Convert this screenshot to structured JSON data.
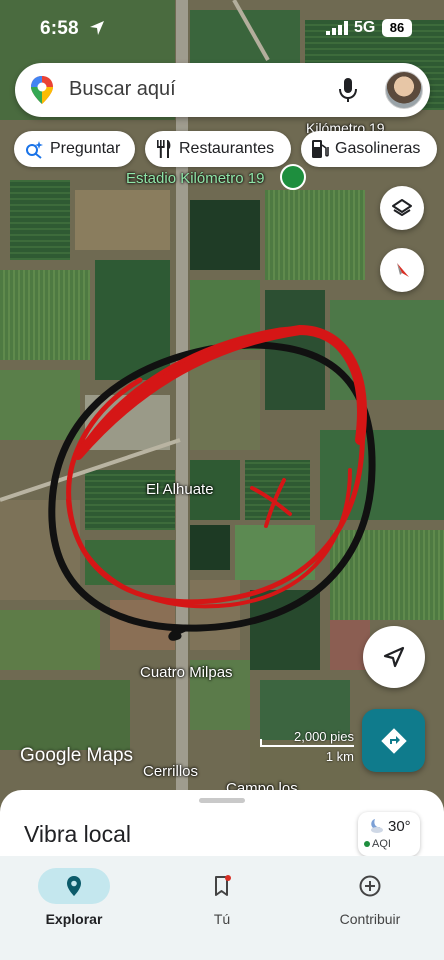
{
  "status_bar": {
    "time": "6:58",
    "network": "5G",
    "battery": "86"
  },
  "search": {
    "placeholder": "Buscar aquí"
  },
  "chips": [
    {
      "label": "Preguntar"
    },
    {
      "label": "Restaurantes"
    },
    {
      "label": "Gasolineras"
    }
  ],
  "map": {
    "labels": {
      "stadium": "Estadio Kilómetro 19",
      "km19": "Kilómetro 19",
      "alhuate": "El Alhuate",
      "cuatro_milpas": "Cuatro Milpas",
      "cerrillos": "Cerrillos",
      "campo": "Campo los"
    },
    "logo": "Google Maps",
    "scale": {
      "imperial": "2,000 pies",
      "metric": "1 km"
    },
    "annotation_color": "#e01b1b"
  },
  "sheet": {
    "title": "Vibra local"
  },
  "weather": {
    "temperature": "30°",
    "aqi_label": "AQI"
  },
  "nav": {
    "items": [
      {
        "label": "Explorar",
        "icon": "location-pin-icon",
        "active": true
      },
      {
        "label": "Tú",
        "icon": "bookmark-icon"
      },
      {
        "label": "Contribuir",
        "icon": "add-circle-icon"
      }
    ]
  },
  "colors": {
    "accent_teal": "#0f7b8c",
    "nav_active_pill": "#c4e7ee"
  }
}
